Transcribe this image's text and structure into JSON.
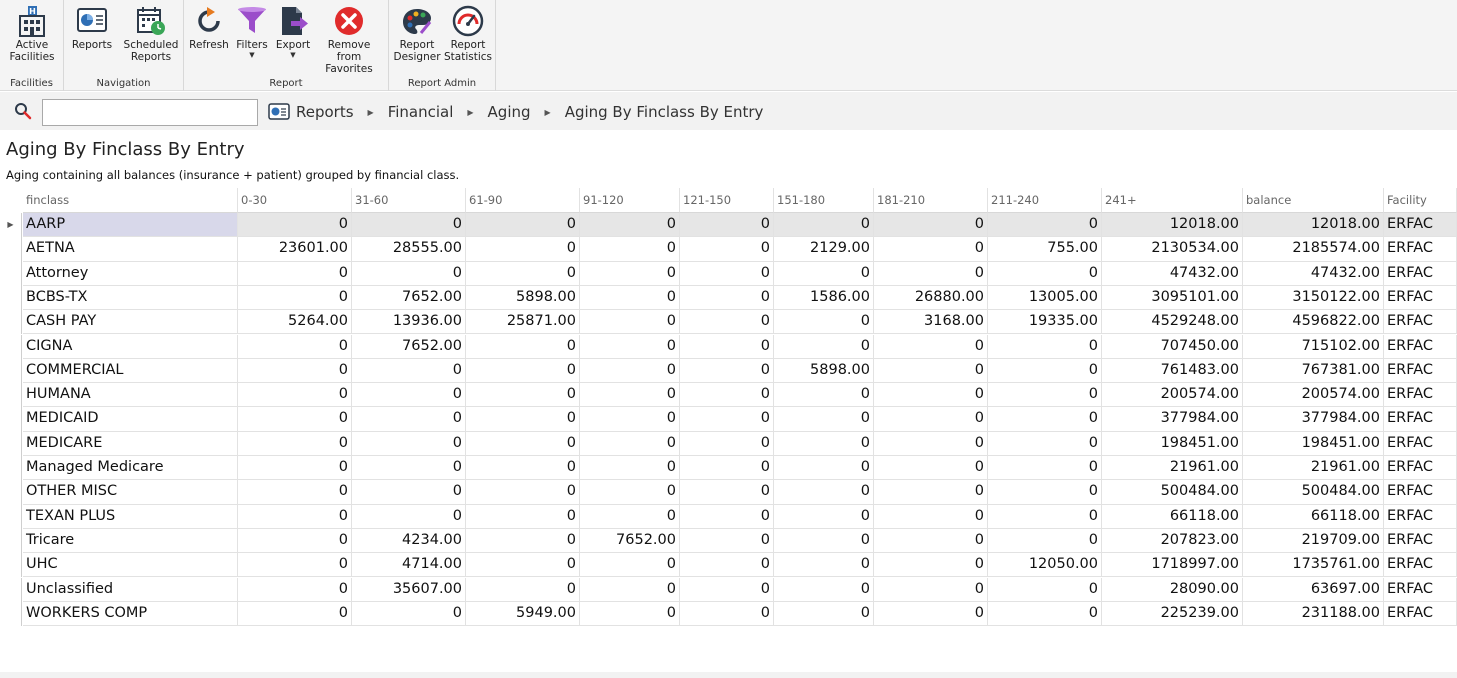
{
  "ribbon": {
    "groups": [
      {
        "label": "Facilities",
        "buttons": [
          {
            "label": "Active\nFacilities",
            "icon": "building-icon",
            "has_dropdown": true
          }
        ]
      },
      {
        "label": "Navigation",
        "buttons": [
          {
            "label": "Reports",
            "icon": "reports-icon"
          },
          {
            "label": "Scheduled\nReports",
            "icon": "calendar-clock-icon"
          }
        ]
      },
      {
        "label": "Report",
        "buttons": [
          {
            "label": "Refresh",
            "icon": "refresh-icon"
          },
          {
            "label": "Filters",
            "icon": "funnel-icon",
            "has_dropdown": true
          },
          {
            "label": "Export",
            "icon": "export-icon",
            "has_dropdown": true
          },
          {
            "label": "Remove from\nFavorites",
            "icon": "remove-circle-icon"
          }
        ]
      },
      {
        "label": "Report Admin",
        "buttons": [
          {
            "label": "Report\nDesigner",
            "icon": "palette-icon"
          },
          {
            "label": "Report\nStatistics",
            "icon": "gauge-icon"
          }
        ]
      }
    ]
  },
  "search": {
    "value": "",
    "placeholder": ""
  },
  "breadcrumb": [
    "Reports",
    "Financial",
    "Aging",
    "Aging By Finclass By Entry"
  ],
  "report": {
    "title": "Aging By Finclass By Entry",
    "description": "Aging containing all balances (insurance + patient) grouped by financial class."
  },
  "table": {
    "columns": [
      "finclass",
      "0-30",
      "31-60",
      "61-90",
      "91-120",
      "121-150",
      "151-180",
      "181-210",
      "211-240",
      "241+",
      "balance",
      "Facility"
    ],
    "rows": [
      [
        "AARP",
        "0",
        "0",
        "0",
        "0",
        "0",
        "0",
        "0",
        "0",
        "12018.00",
        "12018.00",
        "ERFAC"
      ],
      [
        "AETNA",
        "23601.00",
        "28555.00",
        "0",
        "0",
        "0",
        "2129.00",
        "0",
        "755.00",
        "2130534.00",
        "2185574.00",
        "ERFAC"
      ],
      [
        "Attorney",
        "0",
        "0",
        "0",
        "0",
        "0",
        "0",
        "0",
        "0",
        "47432.00",
        "47432.00",
        "ERFAC"
      ],
      [
        "BCBS-TX",
        "0",
        "7652.00",
        "5898.00",
        "0",
        "0",
        "1586.00",
        "26880.00",
        "13005.00",
        "3095101.00",
        "3150122.00",
        "ERFAC"
      ],
      [
        "CASH PAY",
        "5264.00",
        "13936.00",
        "25871.00",
        "0",
        "0",
        "0",
        "3168.00",
        "19335.00",
        "4529248.00",
        "4596822.00",
        "ERFAC"
      ],
      [
        "CIGNA",
        "0",
        "7652.00",
        "0",
        "0",
        "0",
        "0",
        "0",
        "0",
        "707450.00",
        "715102.00",
        "ERFAC"
      ],
      [
        "COMMERCIAL",
        "0",
        "0",
        "0",
        "0",
        "0",
        "5898.00",
        "0",
        "0",
        "761483.00",
        "767381.00",
        "ERFAC"
      ],
      [
        "HUMANA",
        "0",
        "0",
        "0",
        "0",
        "0",
        "0",
        "0",
        "0",
        "200574.00",
        "200574.00",
        "ERFAC"
      ],
      [
        "MEDICAID",
        "0",
        "0",
        "0",
        "0",
        "0",
        "0",
        "0",
        "0",
        "377984.00",
        "377984.00",
        "ERFAC"
      ],
      [
        "MEDICARE",
        "0",
        "0",
        "0",
        "0",
        "0",
        "0",
        "0",
        "0",
        "198451.00",
        "198451.00",
        "ERFAC"
      ],
      [
        "Managed Medicare",
        "0",
        "0",
        "0",
        "0",
        "0",
        "0",
        "0",
        "0",
        "21961.00",
        "21961.00",
        "ERFAC"
      ],
      [
        "OTHER MISC",
        "0",
        "0",
        "0",
        "0",
        "0",
        "0",
        "0",
        "0",
        "500484.00",
        "500484.00",
        "ERFAC"
      ],
      [
        "TEXAN PLUS",
        "0",
        "0",
        "0",
        "0",
        "0",
        "0",
        "0",
        "0",
        "66118.00",
        "66118.00",
        "ERFAC"
      ],
      [
        "Tricare",
        "0",
        "4234.00",
        "0",
        "7652.00",
        "0",
        "0",
        "0",
        "0",
        "207823.00",
        "219709.00",
        "ERFAC"
      ],
      [
        "UHC",
        "0",
        "4714.00",
        "0",
        "0",
        "0",
        "0",
        "0",
        "12050.00",
        "1718997.00",
        "1735761.00",
        "ERFAC"
      ],
      [
        "Unclassified",
        "0",
        "35607.00",
        "0",
        "0",
        "0",
        "0",
        "0",
        "0",
        "28090.00",
        "63697.00",
        "ERFAC"
      ],
      [
        "WORKERS COMP",
        "0",
        "0",
        "5949.00",
        "0",
        "0",
        "0",
        "0",
        "0",
        "225239.00",
        "231188.00",
        "ERFAC"
      ]
    ],
    "selected_row": 0
  },
  "colors": {
    "ribbon_bg": "#f4f4f4",
    "selected_row_bg": "#e6e6e6",
    "selected_cell_bg": "#d8d8ea",
    "accent_blue": "#2f6fb5",
    "accent_purple": "#9b4dca",
    "accent_red": "#e02b2b"
  }
}
